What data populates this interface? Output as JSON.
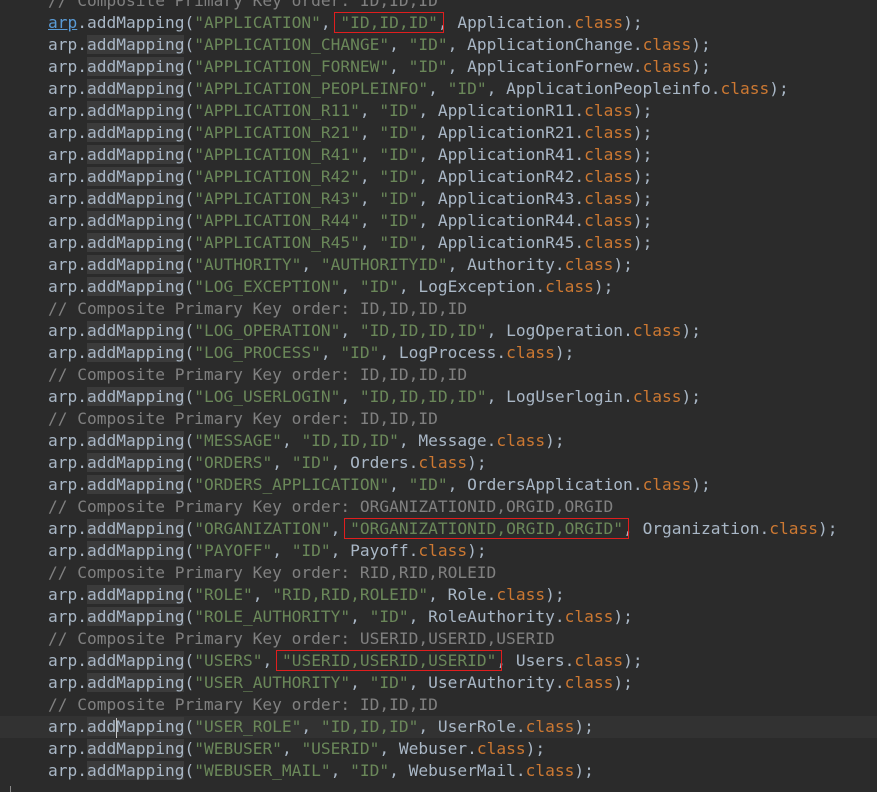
{
  "editor": {
    "comment_prefix": "// ",
    "lines": [
      {
        "type": "comment",
        "text": "Composite Primary Key order: ID,ID,ID"
      },
      {
        "type": "code",
        "obj": "arp",
        "method": "addMapping",
        "table": "\"APPLICATION\"",
        "keys": "\"ID,ID,ID\"",
        "cls": "Application",
        "kw": "class",
        "boxed": true
      },
      {
        "type": "code",
        "obj": "arp",
        "method": "addMapping",
        "table": "\"APPLICATION_CHANGE\"",
        "keys": "\"ID\"",
        "cls": "ApplicationChange",
        "kw": "class"
      },
      {
        "type": "code",
        "obj": "arp",
        "method": "addMapping",
        "table": "\"APPLICATION_FORNEW\"",
        "keys": "\"ID\"",
        "cls": "ApplicationFornew",
        "kw": "class"
      },
      {
        "type": "code",
        "obj": "arp",
        "method": "addMapping",
        "table": "\"APPLICATION_PEOPLEINFO\"",
        "keys": "\"ID\"",
        "cls": "ApplicationPeopleinfo",
        "kw": "class"
      },
      {
        "type": "code",
        "obj": "arp",
        "method": "addMapping",
        "table": "\"APPLICATION_R11\"",
        "keys": "\"ID\"",
        "cls": "ApplicationR11",
        "kw": "class"
      },
      {
        "type": "code",
        "obj": "arp",
        "method": "addMapping",
        "table": "\"APPLICATION_R21\"",
        "keys": "\"ID\"",
        "cls": "ApplicationR21",
        "kw": "class"
      },
      {
        "type": "code",
        "obj": "arp",
        "method": "addMapping",
        "table": "\"APPLICATION_R41\"",
        "keys": "\"ID\"",
        "cls": "ApplicationR41",
        "kw": "class"
      },
      {
        "type": "code",
        "obj": "arp",
        "method": "addMapping",
        "table": "\"APPLICATION_R42\"",
        "keys": "\"ID\"",
        "cls": "ApplicationR42",
        "kw": "class"
      },
      {
        "type": "code",
        "obj": "arp",
        "method": "addMapping",
        "table": "\"APPLICATION_R43\"",
        "keys": "\"ID\"",
        "cls": "ApplicationR43",
        "kw": "class"
      },
      {
        "type": "code",
        "obj": "arp",
        "method": "addMapping",
        "table": "\"APPLICATION_R44\"",
        "keys": "\"ID\"",
        "cls": "ApplicationR44",
        "kw": "class"
      },
      {
        "type": "code",
        "obj": "arp",
        "method": "addMapping",
        "table": "\"APPLICATION_R45\"",
        "keys": "\"ID\"",
        "cls": "ApplicationR45",
        "kw": "class"
      },
      {
        "type": "code",
        "obj": "arp",
        "method": "addMapping",
        "table": "\"AUTHORITY\"",
        "keys": "\"AUTHORITYID\"",
        "cls": "Authority",
        "kw": "class"
      },
      {
        "type": "code",
        "obj": "arp",
        "method": "addMapping",
        "table": "\"LOG_EXCEPTION\"",
        "keys": "\"ID\"",
        "cls": "LogException",
        "kw": "class"
      },
      {
        "type": "comment",
        "text": "Composite Primary Key order: ID,ID,ID,ID"
      },
      {
        "type": "code",
        "obj": "arp",
        "method": "addMapping",
        "table": "\"LOG_OPERATION\"",
        "keys": "\"ID,ID,ID,ID\"",
        "cls": "LogOperation",
        "kw": "class"
      },
      {
        "type": "code",
        "obj": "arp",
        "method": "addMapping",
        "table": "\"LOG_PROCESS\"",
        "keys": "\"ID\"",
        "cls": "LogProcess",
        "kw": "class"
      },
      {
        "type": "comment",
        "text": "Composite Primary Key order: ID,ID,ID,ID"
      },
      {
        "type": "code",
        "obj": "arp",
        "method": "addMapping",
        "table": "\"LOG_USERLOGIN\"",
        "keys": "\"ID,ID,ID,ID\"",
        "cls": "LogUserlogin",
        "kw": "class"
      },
      {
        "type": "comment",
        "text": "Composite Primary Key order: ID,ID,ID"
      },
      {
        "type": "code",
        "obj": "arp",
        "method": "addMapping",
        "table": "\"MESSAGE\"",
        "keys": "\"ID,ID,ID\"",
        "cls": "Message",
        "kw": "class"
      },
      {
        "type": "code",
        "obj": "arp",
        "method": "addMapping",
        "table": "\"ORDERS\"",
        "keys": "\"ID\"",
        "cls": "Orders",
        "kw": "class"
      },
      {
        "type": "code",
        "obj": "arp",
        "method": "addMapping",
        "table": "\"ORDERS_APPLICATION\"",
        "keys": "\"ID\"",
        "cls": "OrdersApplication",
        "kw": "class"
      },
      {
        "type": "comment",
        "text": "Composite Primary Key order: ORGANIZATIONID,ORGID,ORGID"
      },
      {
        "type": "code",
        "obj": "arp",
        "method": "addMapping",
        "table": "\"ORGANIZATION\"",
        "keys": "\"ORGANIZATIONID,ORGID,ORGID\"",
        "cls": "Organization",
        "kw": "class",
        "boxed": true
      },
      {
        "type": "code",
        "obj": "arp",
        "method": "addMapping",
        "table": "\"PAYOFF\"",
        "keys": "\"ID\"",
        "cls": "Payoff",
        "kw": "class"
      },
      {
        "type": "comment",
        "text": "Composite Primary Key order: RID,RID,ROLEID"
      },
      {
        "type": "code",
        "obj": "arp",
        "method": "addMapping",
        "table": "\"ROLE\"",
        "keys": "\"RID,RID,ROLEID\"",
        "cls": "Role",
        "kw": "class"
      },
      {
        "type": "code",
        "obj": "arp",
        "method": "addMapping",
        "table": "\"ROLE_AUTHORITY\"",
        "keys": "\"ID\"",
        "cls": "RoleAuthority",
        "kw": "class"
      },
      {
        "type": "comment",
        "text": "Composite Primary Key order: USERID,USERID,USERID"
      },
      {
        "type": "code",
        "obj": "arp",
        "method": "addMapping",
        "table": "\"USERS\"",
        "keys": "\"USERID,USERID,USERID\"",
        "cls": "Users",
        "kw": "class",
        "boxed": true
      },
      {
        "type": "code",
        "obj": "arp",
        "method": "addMapping",
        "table": "\"USER_AUTHORITY\"",
        "keys": "\"ID\"",
        "cls": "UserAuthority",
        "kw": "class"
      },
      {
        "type": "comment",
        "text": "Composite Primary Key order: ID,ID,ID"
      },
      {
        "type": "code",
        "obj": "arp",
        "method": "addMapping",
        "table": "\"USER_ROLE\"",
        "keys": "\"ID,ID,ID\"",
        "cls": "UserRole",
        "kw": "class",
        "current": true
      },
      {
        "type": "code",
        "obj": "arp",
        "method": "addMapping",
        "table": "\"WEBUSER\"",
        "keys": "\"USERID\"",
        "cls": "Webuser",
        "kw": "class"
      },
      {
        "type": "code",
        "obj": "arp",
        "method": "addMapping",
        "table": "\"WEBUSER_MAIL\"",
        "keys": "\"ID\"",
        "cls": "WebuserMail",
        "kw": "class"
      }
    ]
  },
  "colors": {
    "background": "#2b2b2b",
    "text": "#a9b7c6",
    "string": "#6a8759",
    "keyword": "#cc7832",
    "comment": "#808080",
    "annotation_box": "#e01e1e"
  }
}
